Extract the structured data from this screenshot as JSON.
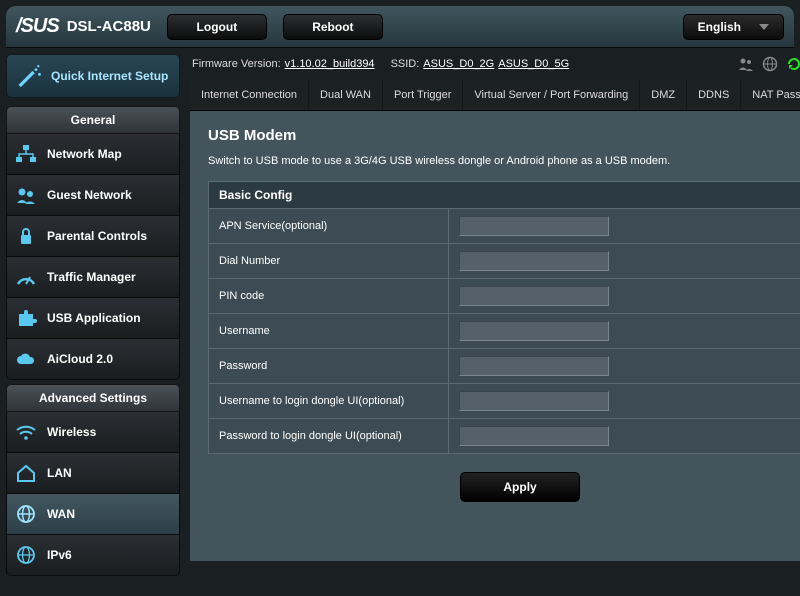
{
  "header": {
    "brand": "/SUS",
    "model": "DSL-AC88U",
    "logout": "Logout",
    "reboot": "Reboot",
    "language": "English"
  },
  "status": {
    "fw_label": "Firmware Version:",
    "fw_value": "v1.10.02_build394",
    "ssid_label": "SSID:",
    "ssid1": "ASUS_D0_2G",
    "ssid2": "ASUS_D0_5G"
  },
  "qis": {
    "label": "Quick Internet Setup"
  },
  "menu": {
    "general_title": "General",
    "general": [
      {
        "label": "Network Map",
        "icon": "network-map"
      },
      {
        "label": "Guest Network",
        "icon": "guest-network"
      },
      {
        "label": "Parental Controls",
        "icon": "parental"
      },
      {
        "label": "Traffic Manager",
        "icon": "traffic"
      },
      {
        "label": "USB Application",
        "icon": "usb-app"
      },
      {
        "label": "AiCloud 2.0",
        "icon": "aicloud"
      }
    ],
    "advanced_title": "Advanced Settings",
    "advanced": [
      {
        "label": "Wireless",
        "icon": "wireless",
        "active": false
      },
      {
        "label": "LAN",
        "icon": "lan",
        "active": false
      },
      {
        "label": "WAN",
        "icon": "wan",
        "active": true
      },
      {
        "label": "IPv6",
        "icon": "ipv6",
        "active": false
      }
    ]
  },
  "tabs": [
    {
      "label": "Internet Connection",
      "active": false
    },
    {
      "label": "Dual WAN",
      "active": false
    },
    {
      "label": "Port Trigger",
      "active": false
    },
    {
      "label": "Virtual Server / Port Forwarding",
      "active": false
    },
    {
      "label": "DMZ",
      "active": false
    },
    {
      "label": "DDNS",
      "active": false
    },
    {
      "label": "NAT Passthrough",
      "active": false
    }
  ],
  "panel": {
    "title": "USB Modem",
    "desc": "Switch to USB mode to use a 3G/4G USB wireless dongle or Android phone as a USB modem.",
    "section": "Basic Config",
    "rows": [
      {
        "label": "APN Service(optional)",
        "value": ""
      },
      {
        "label": "Dial Number",
        "value": ""
      },
      {
        "label": "PIN code",
        "value": ""
      },
      {
        "label": "Username",
        "value": ""
      },
      {
        "label": "Password",
        "value": ""
      },
      {
        "label": "Username to login dongle UI(optional)",
        "value": ""
      },
      {
        "label": "Password to login dongle UI(optional)",
        "value": ""
      }
    ],
    "apply": "Apply"
  }
}
